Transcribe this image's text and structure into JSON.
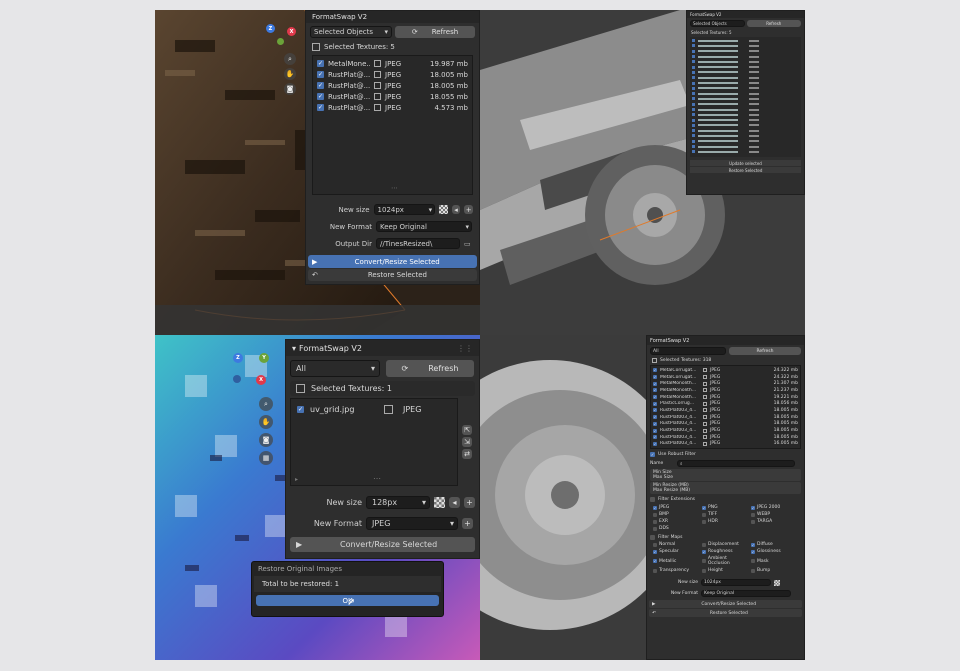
{
  "panel_title": "FormatSwap V2",
  "q1": {
    "source_option": "Selected Objects",
    "refresh_label": "Refresh",
    "selected_textures_label": "Selected Textures: 5",
    "textures": [
      {
        "name": "MetalMone...",
        "format": "JPEG",
        "size": "19.987 mb"
      },
      {
        "name": "RustPlat@...",
        "format": "JPEG",
        "size": "18.005 mb"
      },
      {
        "name": "RustPlat@...",
        "format": "JPEG",
        "size": "18.005 mb"
      },
      {
        "name": "RustPlat@...",
        "format": "JPEG",
        "size": "18.055 mb"
      },
      {
        "name": "RustPlat@...",
        "format": "JPEG",
        "size": "4.573 mb"
      }
    ],
    "new_size_label": "New size",
    "new_size_value": "1024px",
    "new_format_label": "New Format",
    "new_format_value": "Keep Original",
    "output_dir_label": "Output Dir",
    "output_dir_value": "//TinesResized\\",
    "convert_label": "Convert/Resize Selected",
    "restore_label": "Restore Selected"
  },
  "q2": {
    "source_option": "Selected Objects",
    "refresh_label": "Refresh",
    "selected_textures_label": "Selected Textures: 5",
    "footer_a": "Update selected",
    "footer_b": "Restore Selected"
  },
  "q3": {
    "source_option": "All",
    "refresh_label": "Refresh",
    "selected_textures_label": "Selected Textures: 1",
    "texture_name": "uv_grid.jpg",
    "texture_format": "JPEG",
    "new_size_label": "New size",
    "new_size_value": "128px",
    "new_format_label": "New Format",
    "new_format_value": "JPEG",
    "convert_label": "Convert/Resize Selected",
    "dialog_title": "Restore Original Images",
    "dialog_text": "Total to be restored: 1",
    "dialog_ok": "OK"
  },
  "q4": {
    "source_option": "All",
    "refresh_label": "Refresh",
    "selected_textures_label": "Selected Textures: 318",
    "textures": [
      {
        "name": "MetalCorrugat...",
        "format": "JPEG",
        "size": "24.322 mb"
      },
      {
        "name": "MetalCorrugat...",
        "format": "JPEG",
        "size": "24.322 mb"
      },
      {
        "name": "MetalMonolith...",
        "format": "JPEG",
        "size": "21.307 mb"
      },
      {
        "name": "MetalMonolith...",
        "format": "JPEG",
        "size": "21.237 mb"
      },
      {
        "name": "MetalMonolith...",
        "format": "JPEG",
        "size": "19.221 mb"
      },
      {
        "name": "PlasticCorrug...",
        "format": "JPEG",
        "size": "18.056 mb"
      },
      {
        "name": "RustPlat003_4...",
        "format": "JPEG",
        "size": "18.005 mb"
      },
      {
        "name": "RustPlat003_4...",
        "format": "JPEG",
        "size": "18.005 mb"
      },
      {
        "name": "RustPlat003_4...",
        "format": "JPEG",
        "size": "18.005 mb"
      },
      {
        "name": "RustPlat003_4...",
        "format": "JPEG",
        "size": "18.005 mb"
      },
      {
        "name": "RustPlat003_4...",
        "format": "JPEG",
        "size": "18.005 mb"
      },
      {
        "name": "RustPlat003_4...",
        "format": "JPEG",
        "size": "16.005 mb"
      }
    ],
    "use_filter_label": "Use Robust Filter",
    "name_label": "Name",
    "min_size_label": "Min Size",
    "max_size_label": "Max Size",
    "min_resize_label": "Min Resize (MB)",
    "max_resize_label": "Max Resize (MB)",
    "file_extensions_label": "Filter Extensions",
    "extensions": [
      {
        "label": "JPEG",
        "checked": true
      },
      {
        "label": "PNG",
        "checked": true
      },
      {
        "label": "JPEG 2000",
        "checked": true
      },
      {
        "label": "BMP",
        "checked": false
      },
      {
        "label": "TIFF",
        "checked": false
      },
      {
        "label": "WEBP",
        "checked": false
      },
      {
        "label": "EXR",
        "checked": false
      },
      {
        "label": "HDR",
        "checked": false
      },
      {
        "label": "TARGA",
        "checked": false
      },
      {
        "label": "DDS",
        "checked": false
      }
    ],
    "filter_maps_label": "Filter Maps",
    "maps": [
      {
        "label": "Normal",
        "checked": false
      },
      {
        "label": "Displacement",
        "checked": false
      },
      {
        "label": "Diffuse",
        "checked": true
      },
      {
        "label": "Specular",
        "checked": true
      },
      {
        "label": "Roughness",
        "checked": true
      },
      {
        "label": "Glossiness",
        "checked": true
      },
      {
        "label": "Metallic",
        "checked": true
      },
      {
        "label": "Ambient Occlusion",
        "checked": false
      },
      {
        "label": "Mask",
        "checked": false
      },
      {
        "label": "Transparency",
        "checked": false
      },
      {
        "label": "Height",
        "checked": false
      },
      {
        "label": "Bump",
        "checked": false
      }
    ],
    "new_size_label": "New size",
    "new_size_value": "1024px",
    "new_format_label": "New Format",
    "new_format_value": "Keep Original",
    "convert_label": "Convert/Resize Selected",
    "restore_label": "Restore Selected"
  },
  "colors": {
    "accent": "#4772b3",
    "panel_bg": "#2e2e2e",
    "field_bg": "#1d1d1d",
    "gizmo_x": "#e0394b",
    "gizmo_y": "#6ba339",
    "gizmo_z": "#3d7ae0"
  }
}
